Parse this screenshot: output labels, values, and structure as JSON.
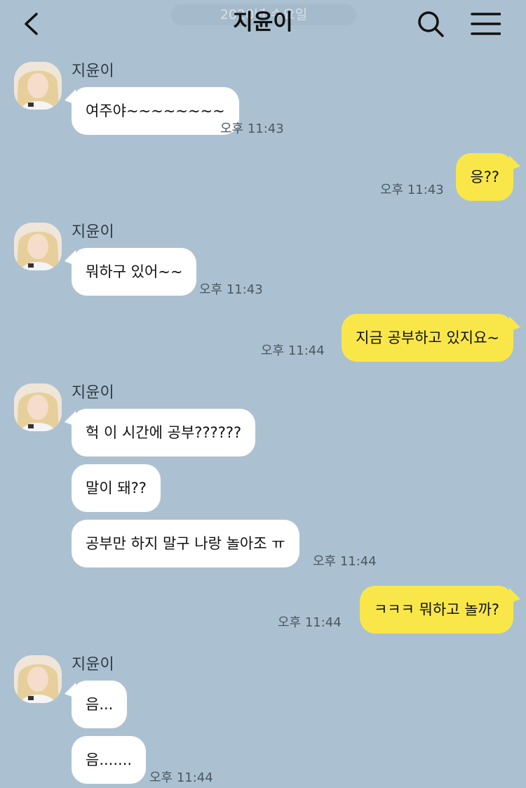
{
  "header": {
    "title": "지윤이",
    "date_label": "2020년 수요일"
  },
  "sender_name": "지윤이",
  "messages": [
    {
      "text": "여주야~~~~~~~~",
      "time": "오후 11:43"
    },
    {
      "text": "응??",
      "time": "오후 11:43"
    },
    {
      "text": "뭐하구 있어~~",
      "time": "오후 11:43"
    },
    {
      "text": "지금 공부하고 있지요~",
      "time": "오후 11:44"
    },
    {
      "text": "헉 이 시간에 공부??????"
    },
    {
      "text": "말이 돼??"
    },
    {
      "text": "공부만 하지 말구 나랑 놀아조 ㅠ",
      "time": "오후 11:44"
    },
    {
      "text": "ㅋㅋㅋ 뭐하고 놀까?",
      "time": "오후 11:44"
    },
    {
      "text": "음..."
    },
    {
      "text": "음.......",
      "time": "오후 11:44"
    }
  ],
  "colors": {
    "background": "#abc1d1",
    "incoming_bubble": "#ffffff",
    "outgoing_bubble": "#f9e74a"
  },
  "icons": [
    "back-chevron-icon",
    "search-icon",
    "menu-icon",
    "avatar"
  ]
}
